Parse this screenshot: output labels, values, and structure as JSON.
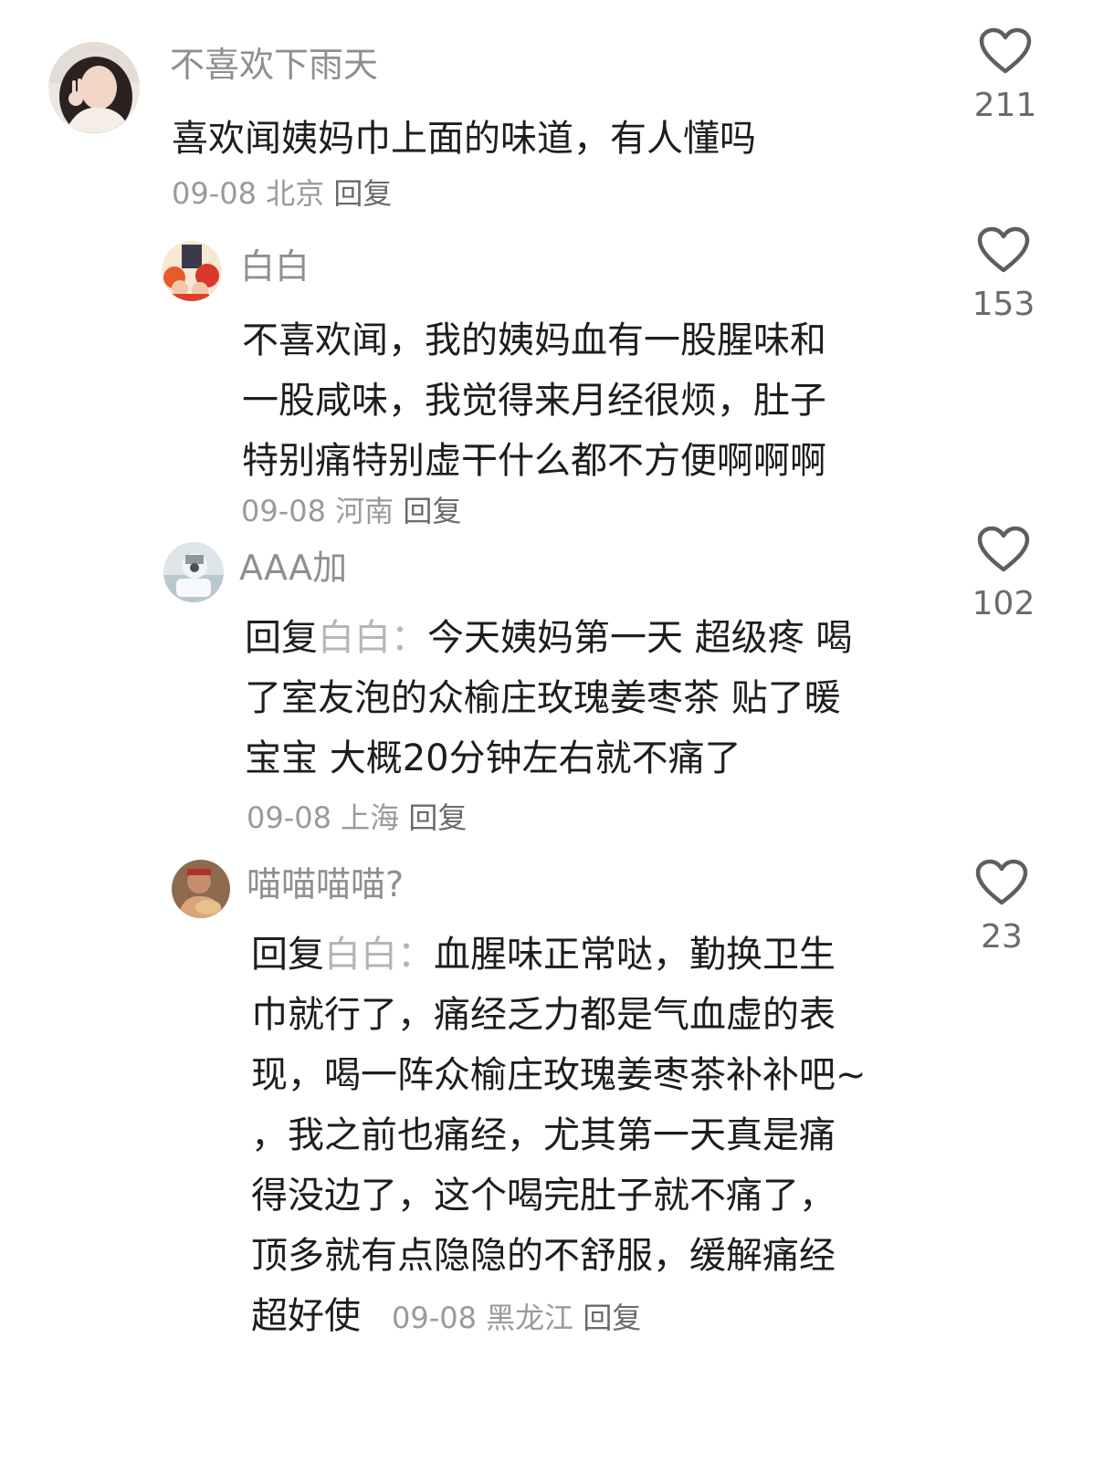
{
  "comments": [
    {
      "username": "不喜欢下雨天",
      "lines": [
        "喜欢闻姨妈巾上面的味道，有人懂吗"
      ],
      "date": "09-08",
      "location": "北京",
      "reply_label": "回复",
      "likes": "211"
    },
    {
      "username": "白白",
      "lines": [
        "不喜欢闻，我的姨妈血有一股腥味和",
        "一股咸味，我觉得来月经很烦，肚子",
        "特别痛特别虚干什么都不方便啊啊啊"
      ],
      "date": "09-08",
      "location": "河南",
      "reply_label": "回复",
      "likes": "153"
    },
    {
      "username": "AAA加",
      "reply_prefix": "回复",
      "reply_to": "白白",
      "reply_colon": "：",
      "lines": [
        "今天姨妈第一天 超级疼 喝",
        "了室友泡的众榆庄玫瑰姜枣茶 贴了暖",
        "宝宝 大概20分钟左右就不痛了"
      ],
      "date": "09-08",
      "location": "上海",
      "reply_label": "回复",
      "likes": "102"
    },
    {
      "username": "喵喵喵喵?",
      "reply_prefix": "回复",
      "reply_to": "白白",
      "reply_colon": "：",
      "lines": [
        "血腥味正常哒，勤换卫生",
        "巾就行了，痛经乏力都是气血虚的表",
        "现，喝一阵众榆庄玫瑰姜枣茶补补吧~",
        "，我之前也痛经，尤其第一天真是痛",
        "得没边了，这个喝完肚子就不痛了，",
        "顶多就有点隐隐的不舒服，缓解痛经",
        "超好使"
      ],
      "date": "09-08",
      "location": "黑龙江",
      "reply_label": "回复",
      "likes": "23"
    }
  ],
  "icons": {
    "like": "heart-outline-icon"
  },
  "colors": {
    "username": "#8f8f8f",
    "body": "#1d1d1d",
    "meta": "#9a9a9a",
    "reply_target": "#b5b5b5",
    "icon": "#5e5e5e"
  }
}
